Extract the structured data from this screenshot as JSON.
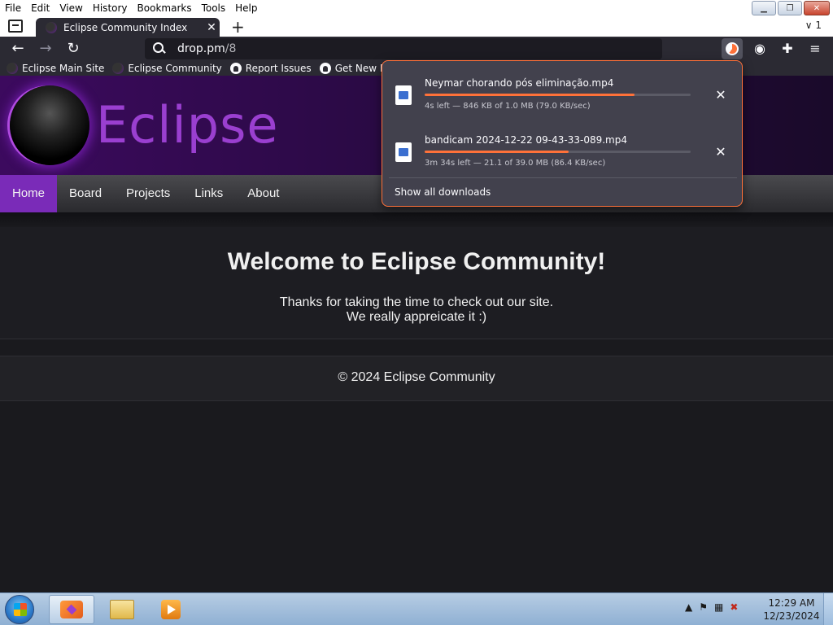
{
  "menubar": {
    "items": [
      "File",
      "Edit",
      "View",
      "History",
      "Bookmarks",
      "Tools",
      "Help"
    ]
  },
  "tab": {
    "title": "Eclipse Community Index",
    "list_count": "1"
  },
  "urlbar": {
    "host": "drop.pm",
    "path": "/8"
  },
  "bookmarks": [
    {
      "label": "Eclipse Main Site",
      "icon": "eclipse-icon"
    },
    {
      "label": "Eclipse Community",
      "icon": "eclipse-icon"
    },
    {
      "label": "Report Issues",
      "icon": "github-icon"
    },
    {
      "label": "Get New Releases",
      "icon": "github-icon"
    }
  ],
  "site": {
    "logo_text": "Eclipse",
    "nav": [
      "Home",
      "Board",
      "Projects",
      "Links",
      "About"
    ],
    "active_nav": "Home",
    "welcome": "Welcome to Eclipse Community!",
    "subtext_line1": "Thanks for taking the time to check out our site.",
    "subtext_line2": "We really appreicate it :)",
    "copyright": "© 2024 Eclipse Community"
  },
  "downloads": {
    "items": [
      {
        "name": "Neymar chorando pós eliminação.mp4",
        "status": "4s left — 846 KB of 1.0 MB (79.0 KB/sec)",
        "progress": 0.79
      },
      {
        "name": "bandicam 2024-12-22 09-43-33-089.mp4",
        "status": "3m 34s left — 21.1 of 39.0 MB (86.4 KB/sec)",
        "progress": 0.54
      }
    ],
    "show_all": "Show all downloads"
  },
  "taskbar": {
    "time": "12:29 AM",
    "date": "12/23/2024"
  },
  "colors": {
    "accent": "#ff7139",
    "brand_purple": "#9a3fd0",
    "nav_active": "#7a2bb8"
  }
}
